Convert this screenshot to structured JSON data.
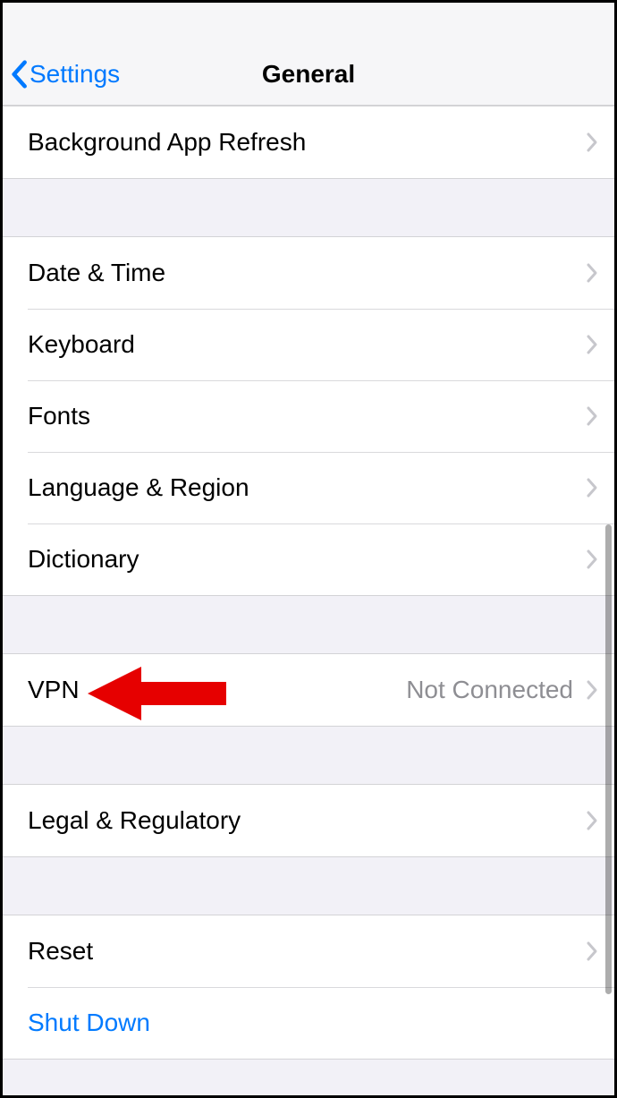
{
  "navbar": {
    "back_label": "Settings",
    "title": "General"
  },
  "groups": [
    {
      "rows": [
        {
          "label": "Background App Refresh"
        }
      ]
    },
    {
      "rows": [
        {
          "label": "Date & Time"
        },
        {
          "label": "Keyboard"
        },
        {
          "label": "Fonts"
        },
        {
          "label": "Language & Region"
        },
        {
          "label": "Dictionary"
        }
      ]
    },
    {
      "rows": [
        {
          "label": "VPN",
          "detail": "Not Connected"
        }
      ]
    },
    {
      "rows": [
        {
          "label": "Legal & Regulatory"
        }
      ]
    },
    {
      "rows": [
        {
          "label": "Reset"
        },
        {
          "label": "Shut Down",
          "action": true
        }
      ]
    }
  ]
}
